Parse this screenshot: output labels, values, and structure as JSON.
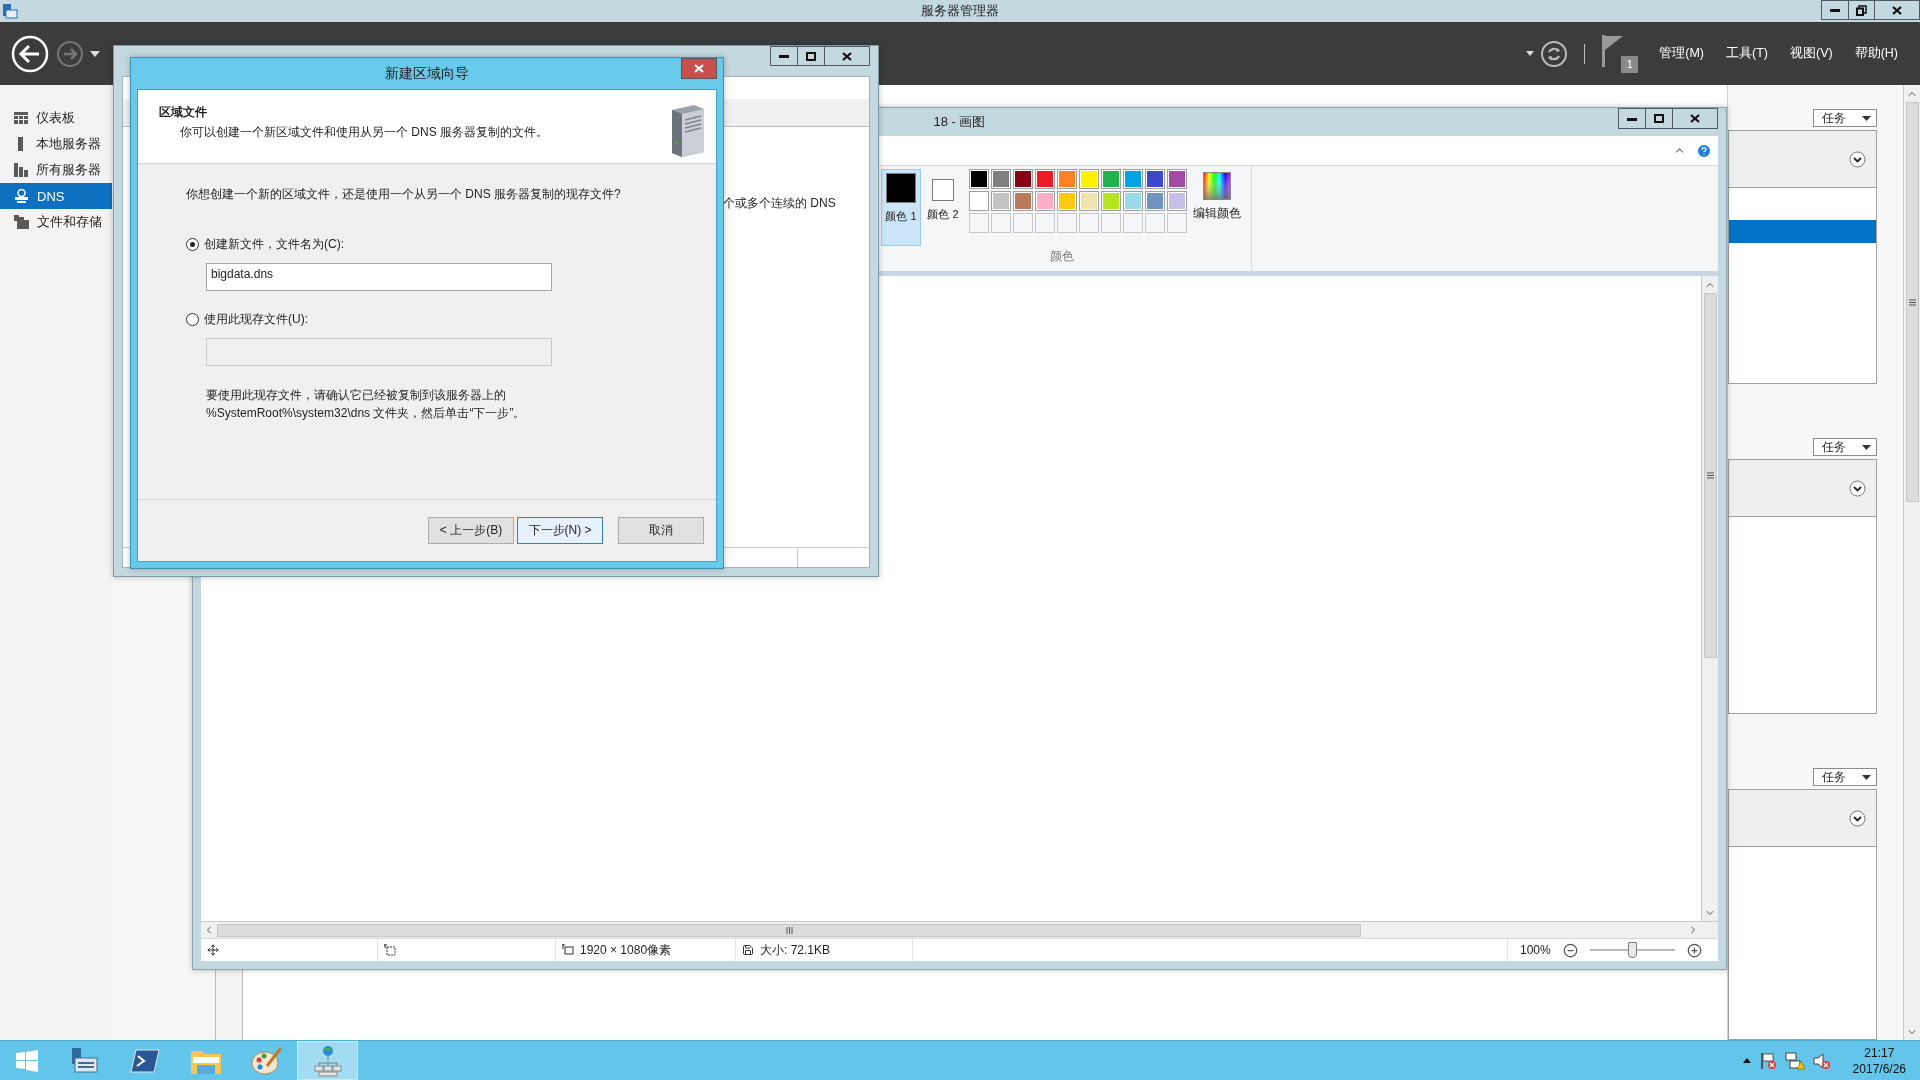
{
  "server_manager": {
    "title": "服务器管理器",
    "menu": [
      "管理(M)",
      "工具(T)",
      "视图(V)",
      "帮助(H)"
    ],
    "notification_count": "1",
    "sidebar": [
      {
        "label": "仪表板",
        "kind": "dashboard",
        "selected": false
      },
      {
        "label": "本地服务器",
        "kind": "server",
        "selected": false
      },
      {
        "label": "所有服务器",
        "kind": "servers",
        "selected": false
      },
      {
        "label": "DNS",
        "kind": "dns",
        "selected": true
      },
      {
        "label": "文件和存储",
        "kind": "storage",
        "selected": false
      }
    ],
    "task_panels": [
      {
        "button": "任务"
      },
      {
        "button": "任务"
      },
      {
        "button": "任务"
      }
    ]
  },
  "dns_manager": {
    "text": "个或多个连续的 DNS"
  },
  "paint": {
    "title": "18 - 画图",
    "color_slots": [
      {
        "label": "颜色 1",
        "color": "#000000",
        "selected": true
      },
      {
        "label": "颜色 2",
        "color": "#ffffff",
        "selected": false
      }
    ],
    "palette": [
      {
        "color": "#000000"
      },
      {
        "color": "#7f7f7f"
      },
      {
        "color": "#880015"
      },
      {
        "color": "#ed1c24"
      },
      {
        "color": "#ff7f27"
      },
      {
        "color": "#fff200"
      },
      {
        "color": "#22b14c"
      },
      {
        "color": "#00a2e8"
      },
      {
        "color": "#3f48cc"
      },
      {
        "color": "#a349a4"
      },
      {
        "color": "#ffffff"
      },
      {
        "color": "#c3c3c3"
      },
      {
        "color": "#b97a57"
      },
      {
        "color": "#ffaec9"
      },
      {
        "color": "#ffc90e"
      },
      {
        "color": "#efe4b0"
      },
      {
        "color": "#b5e61d"
      },
      {
        "color": "#99d9ea"
      },
      {
        "color": "#7092be"
      },
      {
        "color": "#c8bfe7"
      }
    ],
    "edit_colors": "编辑颜色",
    "group_label": "颜色",
    "status": {
      "dimensions": "1920 × 1080像素",
      "size": "大小: 72.1KB",
      "zoom": "100%"
    },
    "zoom_slider": {
      "level": 0.5
    }
  },
  "wizard": {
    "title": "新建区域向导",
    "heading": "区域文件",
    "subheading": "你可以创建一个新区域文件和使用从另一个 DNS 服务器复制的文件。",
    "question": "你想创建一个新的区域文件，还是使用一个从另一个 DNS 服务器复制的现存文件?",
    "options": [
      {
        "label": "创建新文件，文件名为(C):",
        "selected": true,
        "value": "bigdata.dns"
      },
      {
        "label": "使用此现存文件(U):",
        "selected": false
      }
    ],
    "note": [
      "要使用此现存文件，请确认它已经被复制到该服务器上的",
      "%SystemRoot%\\system32\\dns 文件夹，然后单击“下一步”。"
    ],
    "buttons": [
      {
        "label": "< 上一步(B)",
        "default": false
      },
      {
        "label": "下一步(N) >",
        "default": true
      },
      {
        "label": "取消",
        "default": false
      }
    ]
  },
  "taskbar": {
    "apps": [
      {
        "kind": "server-manager",
        "selected": false
      },
      {
        "kind": "powershell",
        "selected": false
      },
      {
        "kind": "explorer",
        "selected": false
      },
      {
        "kind": "paint",
        "selected": false
      },
      {
        "kind": "network",
        "selected": true
      }
    ],
    "time": "21:17",
    "date": "2017/6/26"
  }
}
